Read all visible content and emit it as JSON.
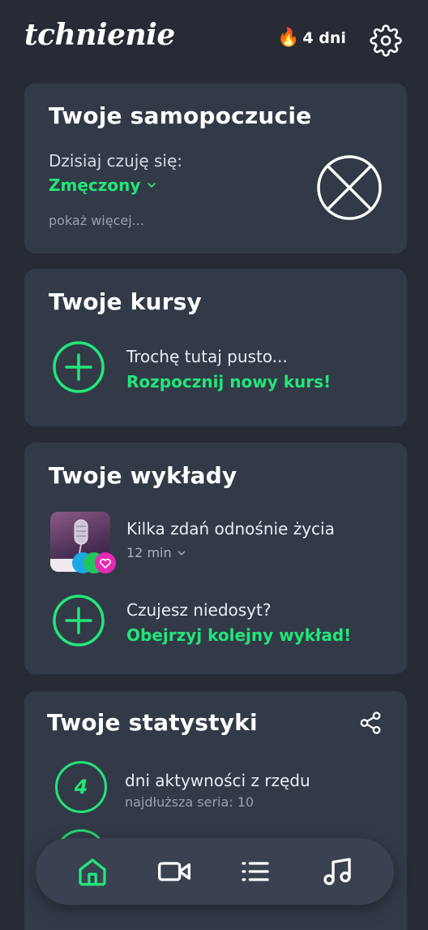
{
  "header": {
    "logo_text": "tchnienie",
    "streak_text": "4 dni",
    "flame_icon": "flame-icon",
    "settings_icon": "gear-icon"
  },
  "wellbeing": {
    "title": "Twoje samopoczucie",
    "feel_label": "Dzisiaj czuję się:",
    "feel_value": "Zmęczony",
    "show_more": "pokaż więcej...",
    "mood_icon": "tired-face-icon"
  },
  "courses": {
    "title": "Twoje kursy",
    "empty_text": "Trochę tutaj pusto...",
    "cta": "Rozpocznij nowy kurs!"
  },
  "lectures": {
    "title": "Twoje wykłady",
    "items": [
      {
        "title": "Kilka zdań odnośnie życia",
        "duration": "12 min"
      }
    ],
    "more_text": "Czujesz niedosyt?",
    "more_cta": "Obejrzyj kolejny wykład!"
  },
  "stats": {
    "title": "Twoje statystyki",
    "items": [
      {
        "value": "4",
        "label": "dni aktywności z rzędu",
        "sub": "najdłuższa seria: 10"
      }
    ]
  },
  "nav": {
    "items": [
      "home-icon",
      "video-icon",
      "list-icon",
      "music-icon"
    ],
    "active": "home-icon"
  },
  "colors": {
    "background": "#262b36",
    "card": "#333a47",
    "accent": "#22e67a"
  }
}
